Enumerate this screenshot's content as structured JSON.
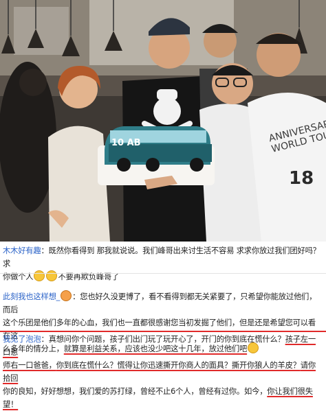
{
  "comments": [
    {
      "user": "木木好有趣",
      "line1": "：既然你看得到 那我就说说。我们峰哥出来讨生活不容易 求求你放过我们团好吗？求",
      "line2_pre": "你做个人",
      "line2_post": "不要再欺负峰哥了"
    },
    {
      "user": "此刻我也这样想_",
      "line1": "：您也好久没更博了，看不看得到都无关紧要了，只希望你能放过他们，而后",
      "line2": "这个乐团是他们多年的心血，我们也一直都很感谢您当初发掘了他们，但是还是希望您可以看在这",
      "line3_a": "么多年的情分上，",
      "line3_b": "就算是利益关系，应该也没少吧这十几年，放过他们吧"
    },
    {
      "user": "我见了泡泡",
      "line1_a": "：真想问你个问题，孩子们出门玩了玩开心了，开门的你到底在慌什么？",
      "line1_b": "孩子左一口恩",
      "line2_a": "师右一口爸爸，",
      "line2_b": "你到底在慌什么？慌得让你迅速撕开你商人的面具？撕开你狼人的羊皮？",
      "line2_c": "请你拾回",
      "line3_a": "你的良知，好好想想，我们爱的苏打绿，曾经不止6个人，曾经有过你。如今，",
      "line3_b": "你让我们很失望！"
    }
  ],
  "photo": {
    "cake_plate": "10 AB",
    "shirt_text_line1": "ANNIVERSARY",
    "shirt_text_line2": "WORLD TOUR",
    "shirt_number": "18"
  },
  "colors": {
    "username": "#2a62c8",
    "underline": "#e02a2a"
  }
}
